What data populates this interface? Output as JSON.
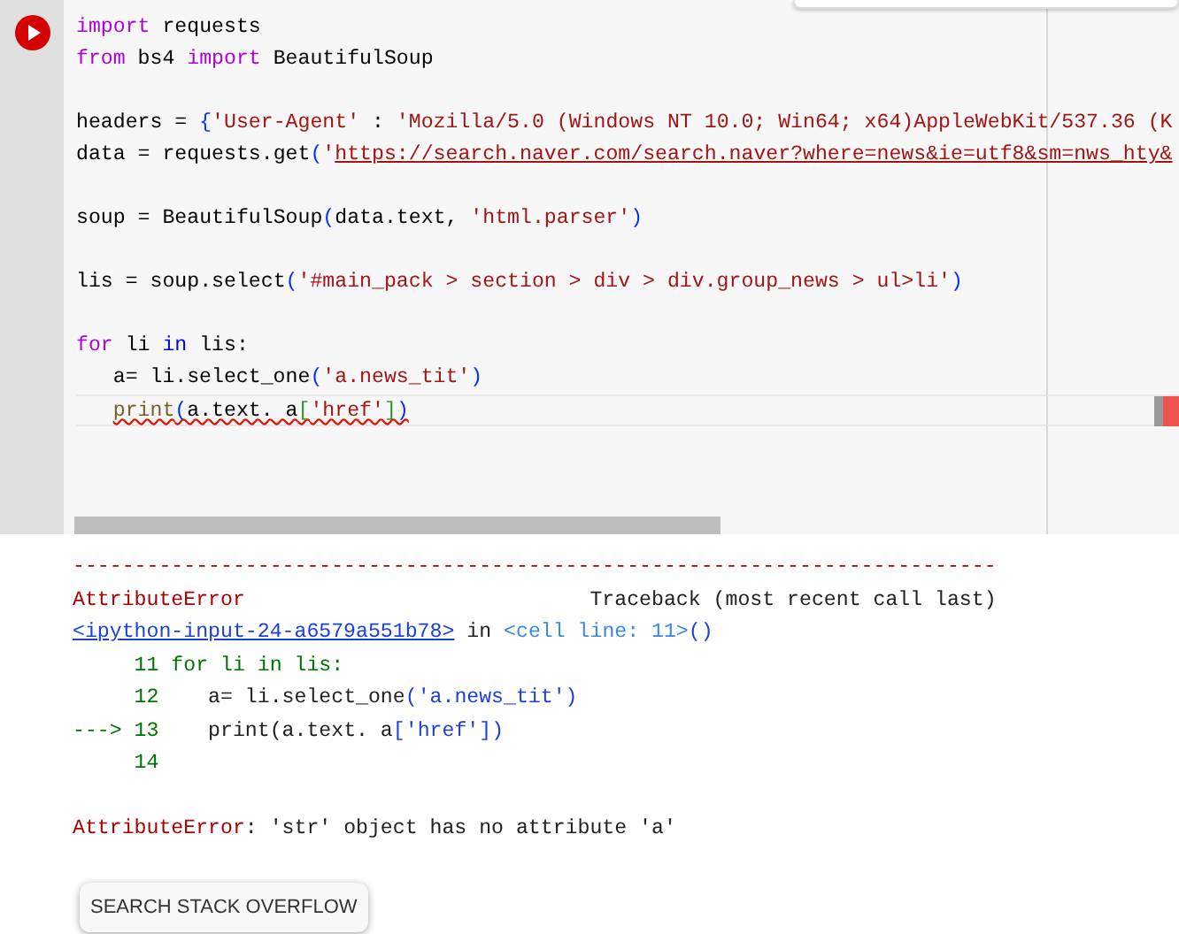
{
  "code_cell": {
    "lines": [
      {
        "kind": "code",
        "indent": false,
        "current": false,
        "error": false,
        "tokens": [
          {
            "kind": "kw",
            "text": "import"
          },
          {
            "kind": "plain",
            "text": " requests"
          }
        ]
      },
      {
        "kind": "code",
        "indent": false,
        "current": false,
        "error": false,
        "tokens": [
          {
            "kind": "kw",
            "text": "from"
          },
          {
            "kind": "plain",
            "text": " bs4 "
          },
          {
            "kind": "kw",
            "text": "import"
          },
          {
            "kind": "plain",
            "text": " BeautifulSoup"
          }
        ]
      },
      {
        "kind": "blank"
      },
      {
        "kind": "code",
        "indent": false,
        "current": false,
        "error": false,
        "tokens": [
          {
            "kind": "plain",
            "text": "headers = "
          },
          {
            "kind": "paren",
            "text": "{"
          },
          {
            "kind": "str",
            "text": "'User-Agent'"
          },
          {
            "kind": "plain",
            "text": " : "
          },
          {
            "kind": "str",
            "text": "'Mozilla/5.0 (Windows NT 10.0; Win64; x64)AppleWebKit/537.36 (K"
          }
        ]
      },
      {
        "kind": "code",
        "indent": false,
        "current": false,
        "error": false,
        "tokens": [
          {
            "kind": "plain",
            "text": "data = requests.get"
          },
          {
            "kind": "paren",
            "text": "("
          },
          {
            "kind": "str",
            "text": "'"
          },
          {
            "kind": "url",
            "text": "https://search.naver.com/search.naver?where=news&ie=utf8&sm=nws_hty&"
          }
        ]
      },
      {
        "kind": "blank"
      },
      {
        "kind": "code",
        "indent": false,
        "current": false,
        "error": false,
        "tokens": [
          {
            "kind": "plain",
            "text": "soup = BeautifulSoup"
          },
          {
            "kind": "paren",
            "text": "("
          },
          {
            "kind": "plain",
            "text": "data.text, "
          },
          {
            "kind": "str",
            "text": "'html.parser'"
          },
          {
            "kind": "paren",
            "text": ")"
          }
        ]
      },
      {
        "kind": "blank"
      },
      {
        "kind": "code",
        "indent": false,
        "current": false,
        "error": false,
        "tokens": [
          {
            "kind": "plain",
            "text": "lis = soup.select"
          },
          {
            "kind": "paren",
            "text": "("
          },
          {
            "kind": "str",
            "text": "'#main_pack > section > div > div.group_news > ul>li'"
          },
          {
            "kind": "paren",
            "text": ")"
          }
        ]
      },
      {
        "kind": "blank"
      },
      {
        "kind": "code",
        "indent": false,
        "current": false,
        "error": false,
        "tokens": [
          {
            "kind": "kw",
            "text": "for"
          },
          {
            "kind": "plain",
            "text": " li "
          },
          {
            "kind": "kwb",
            "text": "in"
          },
          {
            "kind": "plain",
            "text": " lis:"
          }
        ]
      },
      {
        "kind": "code",
        "indent": true,
        "current": false,
        "error": false,
        "tokens": [
          {
            "kind": "plain",
            "text": "a= li.select_one"
          },
          {
            "kind": "paren",
            "text": "("
          },
          {
            "kind": "str",
            "text": "'a.news_tit'"
          },
          {
            "kind": "paren",
            "text": ")"
          }
        ]
      },
      {
        "kind": "code",
        "indent": true,
        "current": true,
        "error": true,
        "tokens": [
          {
            "kind": "func",
            "text": "print"
          },
          {
            "kind": "paren",
            "text": "("
          },
          {
            "kind": "plain",
            "text": "a.text. a"
          },
          {
            "kind": "bracket",
            "text": "["
          },
          {
            "kind": "str",
            "text": "'href'"
          },
          {
            "kind": "bracket",
            "text": "]"
          },
          {
            "kind": "paren",
            "text": ")"
          }
        ]
      }
    ]
  },
  "output": {
    "lines": [
      {
        "kind": "text",
        "tokens": [
          {
            "kind": "err",
            "text": "---------------------------------------------------------------------------"
          }
        ]
      },
      {
        "kind": "text",
        "tokens": [
          {
            "kind": "err",
            "text": "AttributeError"
          },
          {
            "kind": "plain",
            "text": "                            Traceback (most recent call last)"
          }
        ]
      },
      {
        "kind": "text",
        "tokens": [
          {
            "kind": "link",
            "text": "<ipython-input-24-a6579a551b78>"
          },
          {
            "kind": "plain",
            "text": " in "
          },
          {
            "kind": "ref",
            "text": "<cell line: 11>"
          },
          {
            "kind": "blue",
            "text": "()"
          }
        ]
      },
      {
        "kind": "text",
        "tokens": [
          {
            "kind": "green",
            "text": "     11 for li in lis:"
          }
        ]
      },
      {
        "kind": "text",
        "tokens": [
          {
            "kind": "green",
            "text": "     12"
          },
          {
            "kind": "plain",
            "text": "    a= li.select_one"
          },
          {
            "kind": "blue",
            "text": "('a.news_tit')"
          }
        ]
      },
      {
        "kind": "text",
        "tokens": [
          {
            "kind": "green",
            "text": "---> 13"
          },
          {
            "kind": "plain",
            "text": "    print(a.text. a"
          },
          {
            "kind": "blue",
            "text": "['href'])"
          }
        ]
      },
      {
        "kind": "text",
        "tokens": [
          {
            "kind": "green",
            "text": "     14"
          }
        ]
      },
      {
        "kind": "blank"
      },
      {
        "kind": "text",
        "tokens": [
          {
            "kind": "err",
            "text": "AttributeError"
          },
          {
            "kind": "plain",
            "text": ": 'str' object has no attribute 'a'"
          }
        ]
      }
    ],
    "button": "SEARCH STACK OVERFLOW"
  }
}
